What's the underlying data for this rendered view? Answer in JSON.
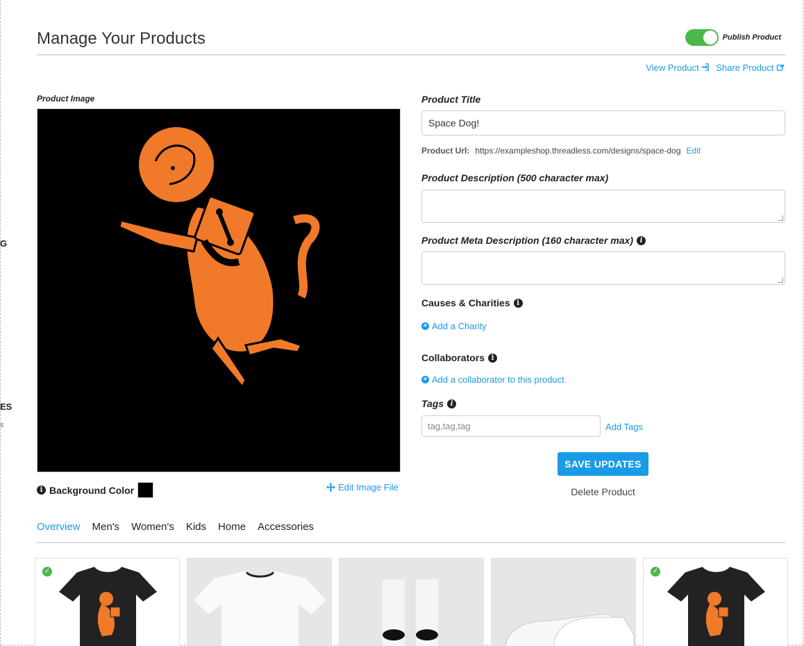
{
  "page": {
    "title": "Manage Your Products"
  },
  "side_fragments": {
    "a": "G",
    "b": "ES",
    "c": "s"
  },
  "publish": {
    "label": "Publish Product",
    "enabled": true,
    "color": "#4cb84c"
  },
  "links": {
    "view_product": "View Product",
    "share_product": "Share Product"
  },
  "image": {
    "label": "Product Image",
    "background_color_label": "Background Color",
    "background_color": "#000000",
    "edit_label": "Edit Image File"
  },
  "form": {
    "title_label": "Product Title",
    "title_value": "Space Dog!",
    "url_label": "Product Url:",
    "url_value": "https://exampleshop.threadless.com/designs/space-dog",
    "url_edit": "Edit",
    "description_label": "Product Description (500 character max)",
    "meta_label": "Product Meta Description (160 character max)",
    "charities_label": "Causes & Charities",
    "add_charity": "Add a Charity",
    "collaborators_label": "Collaborators",
    "add_collaborator": "Add a collaborator to this product",
    "tags_label": "Tags",
    "tags_placeholder": "tag,tag,tag",
    "add_tags": "Add Tags",
    "save": "SAVE UPDATES",
    "delete": "Delete Product"
  },
  "tabs": [
    "Overview",
    "Men's",
    "Women's",
    "Kids",
    "Home",
    "Accessories"
  ],
  "active_tab": "Overview",
  "accent": "#1a9be6",
  "dog_color": "#f07a2a"
}
